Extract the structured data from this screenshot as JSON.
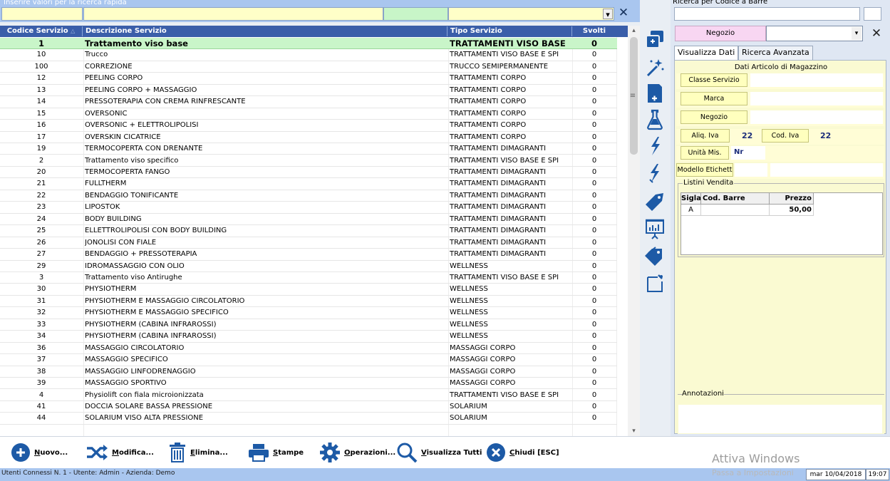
{
  "quick_search": {
    "label": "Inserire valori per la ricerca rapida",
    "tipo_value": "",
    "dropdown_arrow": "▾",
    "clear_label": "✕"
  },
  "grid": {
    "headers": {
      "codice": "Codice Servizio",
      "descrizione": "Descrizione Servizio",
      "tipo": "Tipo Servizio",
      "svolti": "Svolti",
      "sort_indicator": "△"
    },
    "rows": [
      {
        "codice": "1",
        "descrizione": "Trattamento viso base",
        "tipo": "TRATTAMENTI  VISO BASE",
        "svolti": "0"
      },
      {
        "codice": "10",
        "descrizione": "Trucco",
        "tipo": "TRATTAMENTI  VISO BASE E SPI",
        "svolti": "0"
      },
      {
        "codice": "100",
        "descrizione": "CORREZIONE",
        "tipo": "TRUCCO SEMIPERMANENTE",
        "svolti": "0"
      },
      {
        "codice": "12",
        "descrizione": "PEELING CORPO",
        "tipo": "TRATTAMENTI CORPO",
        "svolti": "0"
      },
      {
        "codice": "13",
        "descrizione": "PEELING CORPO + MASSAGGIO",
        "tipo": "TRATTAMENTI CORPO",
        "svolti": "0"
      },
      {
        "codice": "14",
        "descrizione": "PRESSOTERAPIA CON CREMA RINFRESCANTE",
        "tipo": "TRATTAMENTI CORPO",
        "svolti": "0"
      },
      {
        "codice": "15",
        "descrizione": "OVERSONIC",
        "tipo": "TRATTAMENTI CORPO",
        "svolti": "0"
      },
      {
        "codice": "16",
        "descrizione": "OVERSONIC + ELETTROLIPOLISI",
        "tipo": "TRATTAMENTI CORPO",
        "svolti": "0"
      },
      {
        "codice": "17",
        "descrizione": "OVERSKIN CICATRICE",
        "tipo": "TRATTAMENTI CORPO",
        "svolti": "0"
      },
      {
        "codice": "19",
        "descrizione": "TERMOCOPERTA CON DRENANTE",
        "tipo": "TRATTAMENTI DIMAGRANTI",
        "svolti": "0"
      },
      {
        "codice": "2",
        "descrizione": "Trattamento viso specifico",
        "tipo": "TRATTAMENTI  VISO BASE E SPI",
        "svolti": "0"
      },
      {
        "codice": "20",
        "descrizione": "TERMOCOPERTA FANGO",
        "tipo": "TRATTAMENTI DIMAGRANTI",
        "svolti": "0"
      },
      {
        "codice": "21",
        "descrizione": "FULLTHERM",
        "tipo": "TRATTAMENTI DIMAGRANTI",
        "svolti": "0"
      },
      {
        "codice": "22",
        "descrizione": "BENDAGGIO TONIFICANTE",
        "tipo": "TRATTAMENTI DIMAGRANTI",
        "svolti": "0"
      },
      {
        "codice": "23",
        "descrizione": "LIPOSTOK",
        "tipo": "TRATTAMENTI DIMAGRANTI",
        "svolti": "0"
      },
      {
        "codice": "24",
        "descrizione": "BODY BUILDING",
        "tipo": "TRATTAMENTI DIMAGRANTI",
        "svolti": "0"
      },
      {
        "codice": "25",
        "descrizione": "ELLETTROLIPOLISI CON BODY BUILDING",
        "tipo": "TRATTAMENTI DIMAGRANTI",
        "svolti": "0"
      },
      {
        "codice": "26",
        "descrizione": "JONOLISI CON FIALE",
        "tipo": "TRATTAMENTI DIMAGRANTI",
        "svolti": "0"
      },
      {
        "codice": "27",
        "descrizione": "BENDAGGIO + PRESSOTERAPIA",
        "tipo": "TRATTAMENTI DIMAGRANTI",
        "svolti": "0"
      },
      {
        "codice": "29",
        "descrizione": "IDROMASSAGGIO CON OLIO",
        "tipo": "WELLNESS",
        "svolti": "0"
      },
      {
        "codice": "3",
        "descrizione": "Trattamento viso Antirughe",
        "tipo": "TRATTAMENTI  VISO BASE E SPI",
        "svolti": "0"
      },
      {
        "codice": "30",
        "descrizione": "PHYSIOTHERM",
        "tipo": "WELLNESS",
        "svolti": "0"
      },
      {
        "codice": "31",
        "descrizione": "PHYSIOTHERM E MASSAGGIO CIRCOLATORIO",
        "tipo": "WELLNESS",
        "svolti": "0"
      },
      {
        "codice": "32",
        "descrizione": "PHYSIOTHERM E MASSAGGIO SPECIFICO",
        "tipo": "WELLNESS",
        "svolti": "0"
      },
      {
        "codice": "33",
        "descrizione": "PHYSIOTHERM (CABINA INFRAROSSI)",
        "tipo": "WELLNESS",
        "svolti": "0"
      },
      {
        "codice": "34",
        "descrizione": "PHYSIOTHERM (CABINA INFRAROSSI)",
        "tipo": "WELLNESS",
        "svolti": "0"
      },
      {
        "codice": "36",
        "descrizione": "MASSAGGIO CIRCOLATORIO",
        "tipo": "MASSAGGI CORPO",
        "svolti": "0"
      },
      {
        "codice": "37",
        "descrizione": "MASSAGGIO SPECIFICO",
        "tipo": "MASSAGGI CORPO",
        "svolti": "0"
      },
      {
        "codice": "38",
        "descrizione": "MASSAGGIO LINFODRENAGGIO",
        "tipo": "MASSAGGI CORPO",
        "svolti": "0"
      },
      {
        "codice": "39",
        "descrizione": "MASSAGGIO SPORTIVO",
        "tipo": "MASSAGGI CORPO",
        "svolti": "0"
      },
      {
        "codice": "4",
        "descrizione": "Physiolift con fiala microionizzata",
        "tipo": "TRATTAMENTI  VISO BASE E SPI",
        "svolti": "0"
      },
      {
        "codice": "41",
        "descrizione": "DOCCIA SOLARE BASSA PRESSIONE",
        "tipo": "SOLARIUM",
        "svolti": "0"
      },
      {
        "codice": "44",
        "descrizione": "SOLARIUM VISO ALTA PRESSIONE",
        "tipo": "SOLARIUM",
        "svolti": "0"
      }
    ],
    "scroll_up": "▴",
    "scroll_down": "▾",
    "scroll_grip": "≡"
  },
  "side_icons": [
    {
      "name": "copy-window-icon"
    },
    {
      "name": "magic-wand-icon"
    },
    {
      "name": "add-document-icon"
    },
    {
      "name": "flask-icon"
    },
    {
      "name": "lightning-up-icon"
    },
    {
      "name": "lightning-down-icon"
    },
    {
      "name": "price-tag-icon"
    },
    {
      "name": "presentation-chart-icon"
    },
    {
      "name": "double-tag-icon"
    },
    {
      "name": "note-icon"
    }
  ],
  "right_panel": {
    "barcode_label": "Ricerca per Codice a Barre",
    "negozio_label": "Negozio",
    "negozio_value": "",
    "close_label": "✕",
    "tabs": [
      "Visualizza Dati",
      "Ricerca Avanzata"
    ],
    "dati_title": "Dati Articolo di Magazzino",
    "fields": {
      "classe_servizio": "Classe Servizio",
      "marca": "Marca",
      "negozio": "Negozio",
      "aliq_iva": "Aliq. Iva",
      "aliq_iva_value": "22",
      "cod_iva": "Cod. Iva",
      "cod_iva_value": "22",
      "unita_mis": "Unità Mis.",
      "unita_mis_value": "Nr",
      "modello_etichetta": "Modello Etichett"
    },
    "listini": {
      "label": "Listini Vendita",
      "headers": [
        "Sigla",
        "Cod. Barre",
        "Prezzo"
      ],
      "rows": [
        {
          "sigla": "A",
          "cod_barre": "",
          "prezzo": "50,00"
        }
      ]
    },
    "annotazioni_label": "Annotazioni"
  },
  "toolbar": {
    "nuovo": {
      "pre": "",
      "u": "N",
      "post": "uovo..."
    },
    "modifica": {
      "pre": "",
      "u": "M",
      "post": "odifica..."
    },
    "elimina": {
      "pre": "",
      "u": "E",
      "post": "limina..."
    },
    "stampe": {
      "pre": "",
      "u": "S",
      "post": "tampe"
    },
    "operazioni": {
      "pre": "",
      "u": "O",
      "post": "perazioni..."
    },
    "visualizza": {
      "pre": "",
      "u": "V",
      "post": "isualizza Tutti"
    },
    "chiudi": {
      "pre": "",
      "u": "C",
      "post": "hiudi [ESC]"
    }
  },
  "watermark": {
    "line1": "Attiva Windows",
    "line2": "Passa a Impostazioni"
  },
  "status_bar": {
    "text": "Utenti Connessi N. 1 - Utente: Admin - Azienda: Demo",
    "date": "mar 10/04/2018",
    "time": "19:07"
  },
  "colors": {
    "header_blue": "#3a5ea9",
    "strip_blue": "#a9c6ef",
    "selected_row": "#c9f5c9",
    "icon_blue": "#1d5aa6"
  }
}
